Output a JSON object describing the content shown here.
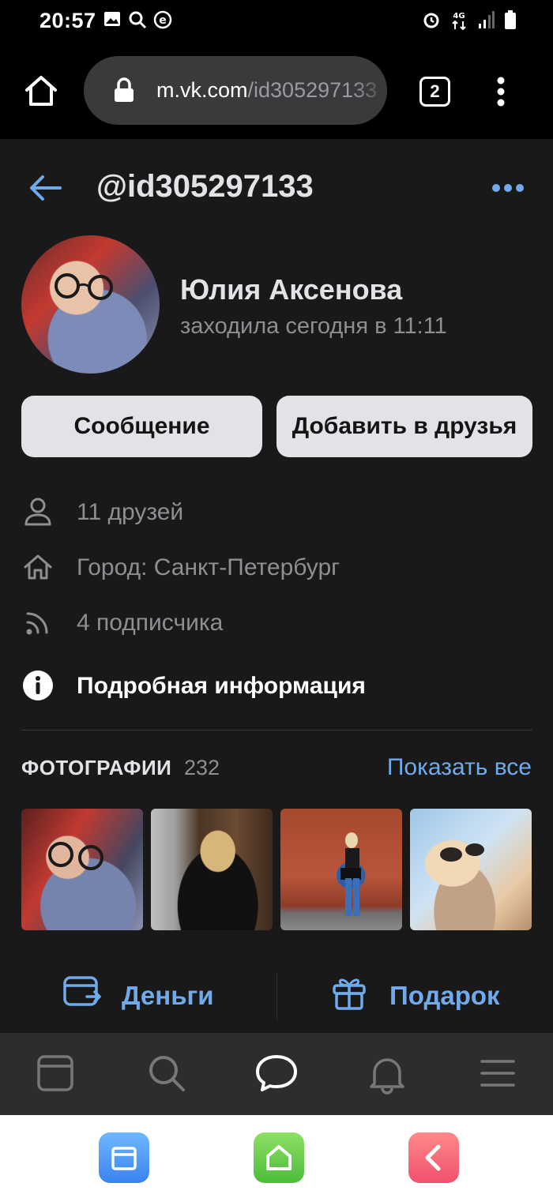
{
  "status_bar": {
    "time": "20:57"
  },
  "browser": {
    "url_host": "m.vk.com",
    "url_path": "/id305297133",
    "tab_count": "2"
  },
  "header": {
    "title": "@id305297133"
  },
  "profile": {
    "name": "Юлия Аксенова",
    "status": "заходила сегодня в 11:11",
    "message_button": "Сообщение",
    "add_friend_button": "Добавить в друзья"
  },
  "info": {
    "friends": "11 друзей",
    "city": "Город: Санкт-Петербург",
    "followers": "4 подписчика",
    "details": "Подробная информация"
  },
  "photos": {
    "heading": "ФОТОГРАФИИ",
    "count": "232",
    "show_all": "Показать все"
  },
  "actions": {
    "money": "Деньги",
    "gift": "Подарок"
  },
  "colors": {
    "accent": "#71aaeb",
    "background": "#19191a",
    "button_bg": "#e1e3e6"
  },
  "icons": [
    "home-icon",
    "lock-icon",
    "tabs-icon",
    "kebab-menu-icon",
    "back-arrow-icon",
    "more-icon",
    "user-icon",
    "house-icon",
    "rss-icon",
    "info-icon",
    "wallet-icon",
    "gift-icon",
    "feed-icon",
    "search-icon",
    "messages-icon",
    "bell-icon",
    "menu-icon"
  ]
}
